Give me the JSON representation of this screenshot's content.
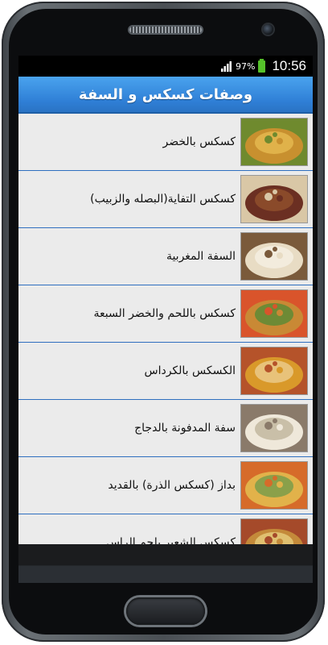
{
  "status_bar": {
    "battery_percent": "97%",
    "time": "10:56",
    "icons": [
      "signal-icon",
      "battery-icon"
    ]
  },
  "app": {
    "title": "وصفات كسكس و السفة"
  },
  "recipes": [
    {
      "label": "كسكس بالخضر",
      "colors": [
        "#c8902f",
        "#6f8a2e",
        "#e0b24a"
      ]
    },
    {
      "label": "كسكس التفاية(البصله والزبيب)",
      "colors": [
        "#6b2f22",
        "#d9c7a6",
        "#8a4a2a"
      ]
    },
    {
      "label": "السفة المغربية",
      "colors": [
        "#e8dcc4",
        "#7a5a3b",
        "#f3ecdd"
      ]
    },
    {
      "label": "كسكس باللحم والخضر السبعة",
      "colors": [
        "#c98935",
        "#d9542b",
        "#6e8a35"
      ]
    },
    {
      "label": "الكسكس بالكرداس",
      "colors": [
        "#d9992a",
        "#b5532a",
        "#e8c27a"
      ]
    },
    {
      "label": "سفة المدفونة بالدجاج",
      "colors": [
        "#efe8da",
        "#8a7a6a",
        "#c9bfa8"
      ]
    },
    {
      "label": "بداز (كسكس الذرة) بالقديد",
      "colors": [
        "#e2b24a",
        "#d66b2a",
        "#8aa04a"
      ]
    },
    {
      "label": "كسكس الشعير بلحم الراس",
      "colors": [
        "#c48a3a",
        "#a54a2a",
        "#e0c070"
      ]
    }
  ]
}
